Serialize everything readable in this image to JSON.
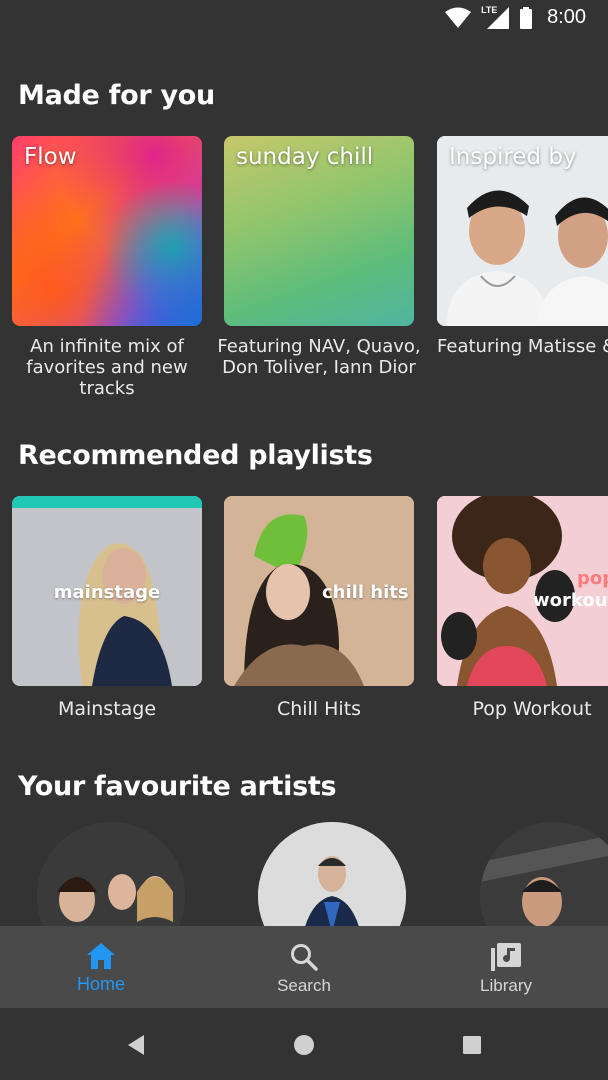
{
  "status_bar": {
    "time": "8:00",
    "network_label": "LTE"
  },
  "sections": {
    "made_for_you": {
      "title": "Made for you",
      "cards": [
        {
          "tile_label": "Flow",
          "description": "An infinite mix of favorites and new tracks"
        },
        {
          "tile_label": "sunday chill",
          "description": "Featuring NAV, Quavo, Don Toliver, Iann Dior"
        },
        {
          "tile_label": "Inspired by",
          "description": "Featuring Matisse & Sadko, Martin Garrix, Clinton Kane, Bon"
        }
      ]
    },
    "recommended_playlists": {
      "title": "Recommended playlists",
      "cards": [
        {
          "overlay": "mainstage",
          "caption": "Mainstage"
        },
        {
          "overlay": "chill hits",
          "caption": "Chill Hits"
        },
        {
          "overlay_top": "pop",
          "overlay": "workout",
          "caption": "Pop Workout"
        }
      ]
    },
    "favourite_artists": {
      "title": "Your favourite artists"
    }
  },
  "bottom_nav": {
    "items": [
      {
        "label": "Home",
        "icon": "home-icon",
        "active": true
      },
      {
        "label": "Search",
        "icon": "search-icon",
        "active": false
      },
      {
        "label": "Library",
        "icon": "library-icon",
        "active": false
      }
    ],
    "active_color": "#2196F3",
    "inactive_color": "#d0d0d0"
  },
  "colors": {
    "background": "#333333",
    "nav_background": "#4a4a4a"
  }
}
